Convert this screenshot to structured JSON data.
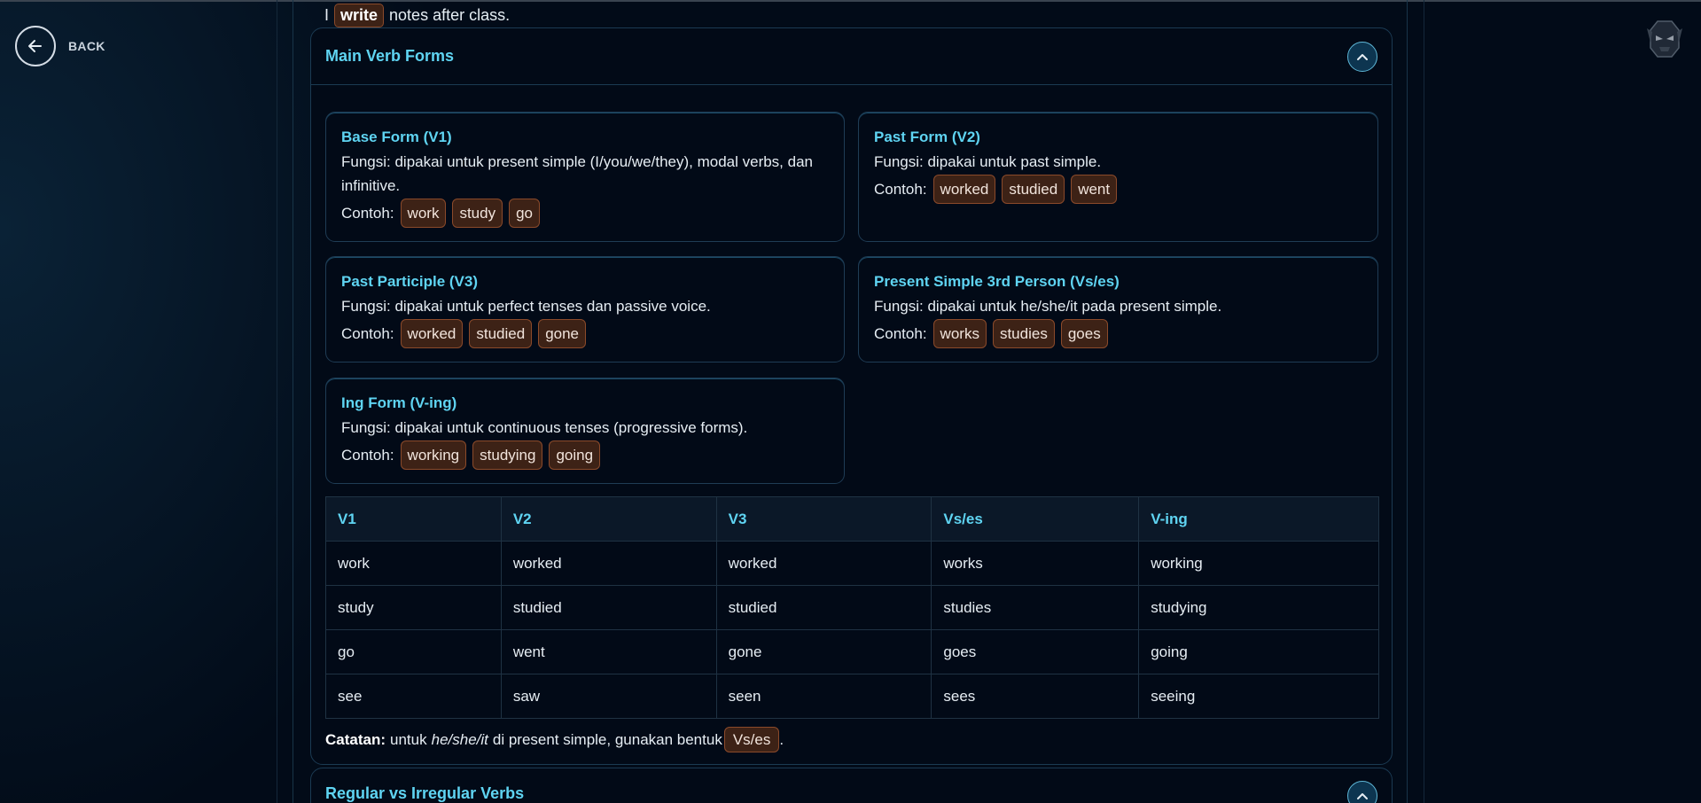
{
  "nav": {
    "back_label": "BACK"
  },
  "intro": {
    "prefix": "I",
    "highlight": "write",
    "suffix": "notes after class."
  },
  "main_panel": {
    "title": "Main Verb Forms",
    "cards": [
      {
        "title": "Base Form (V1)",
        "desc": "Fungsi: dipakai untuk present simple (I/you/we/they), modal verbs, dan infinitive.",
        "example_label": "Contoh:",
        "examples": [
          "work",
          "study",
          "go"
        ]
      },
      {
        "title": "Past Form (V2)",
        "desc": "Fungsi: dipakai untuk past simple.",
        "example_label": "Contoh:",
        "examples": [
          "worked",
          "studied",
          "went"
        ]
      },
      {
        "title": "Past Participle (V3)",
        "desc": "Fungsi: dipakai untuk perfect tenses dan passive voice.",
        "example_label": "Contoh:",
        "examples": [
          "worked",
          "studied",
          "gone"
        ]
      },
      {
        "title": "Present Simple 3rd Person (Vs/es)",
        "desc": "Fungsi: dipakai untuk he/she/it pada present simple.",
        "example_label": "Contoh:",
        "examples": [
          "works",
          "studies",
          "goes"
        ]
      },
      {
        "title": "Ing Form (V-ing)",
        "desc": "Fungsi: dipakai untuk continuous tenses (progressive forms).",
        "example_label": "Contoh:",
        "examples": [
          "working",
          "studying",
          "going"
        ]
      }
    ],
    "table": {
      "headers": [
        "V1",
        "V2",
        "V3",
        "Vs/es",
        "V-ing"
      ],
      "rows": [
        [
          "work",
          "worked",
          "worked",
          "works",
          "working"
        ],
        [
          "study",
          "studied",
          "studied",
          "studies",
          "studying"
        ],
        [
          "go",
          "went",
          "gone",
          "goes",
          "going"
        ],
        [
          "see",
          "saw",
          "seen",
          "sees",
          "seeing"
        ]
      ]
    },
    "note": {
      "label": "Catatan:",
      "pre": "untuk",
      "emph": "he/she/it",
      "post": "di present simple, gunakan bentuk",
      "chip": "Vs/es",
      "end": "."
    }
  },
  "second_panel": {
    "title": "Regular vs Irregular Verbs"
  },
  "icons": {
    "back": "arrow-left-icon",
    "collapse": "chevron-up-icon",
    "mascot": "robot-mascot-icon"
  },
  "colors": {
    "accent": "#5fd4f2",
    "chip_bg": "#3d2216",
    "chip_border": "#8b4a2a",
    "background": "#020b18"
  }
}
